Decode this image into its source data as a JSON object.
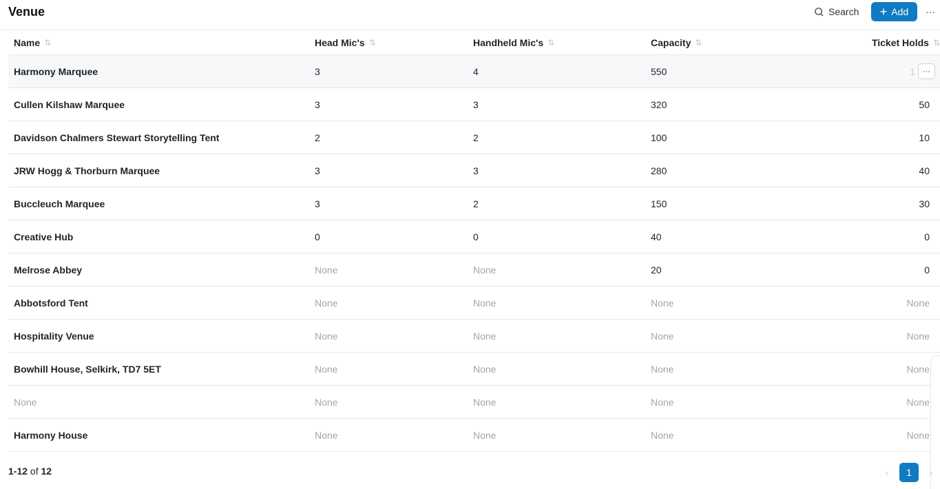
{
  "header": {
    "title": "Venue",
    "search_label": "Search",
    "add_label": "Add",
    "more_label": "···"
  },
  "table": {
    "columns": [
      "Name",
      "Head Mic's",
      "Handheld Mic's",
      "Capacity",
      "Ticket Holds"
    ],
    "sort_icon": "⇅",
    "rows": [
      {
        "name": "Harmony Marquee",
        "head": "3",
        "handheld": "4",
        "capacity": "550",
        "holds": "1"
      },
      {
        "name": "Cullen Kilshaw Marquee",
        "head": "3",
        "handheld": "3",
        "capacity": "320",
        "holds": "50"
      },
      {
        "name": "Davidson Chalmers Stewart Storytelling Tent",
        "head": "2",
        "handheld": "2",
        "capacity": "100",
        "holds": "10"
      },
      {
        "name": "JRW Hogg & Thorburn Marquee",
        "head": "3",
        "handheld": "3",
        "capacity": "280",
        "holds": "40"
      },
      {
        "name": "Buccleuch Marquee",
        "head": "3",
        "handheld": "2",
        "capacity": "150",
        "holds": "30"
      },
      {
        "name": "Creative Hub",
        "head": "0",
        "handheld": "0",
        "capacity": "40",
        "holds": "0"
      },
      {
        "name": "Melrose Abbey",
        "head": "None",
        "handheld": "None",
        "capacity": "20",
        "holds": "0"
      },
      {
        "name": "Abbotsford Tent",
        "head": "None",
        "handheld": "None",
        "capacity": "None",
        "holds": "None"
      },
      {
        "name": "Hospitality Venue",
        "head": "None",
        "handheld": "None",
        "capacity": "None",
        "holds": "None"
      },
      {
        "name": "Bowhill House, Selkirk, TD7 5ET",
        "head": "None",
        "handheld": "None",
        "capacity": "None",
        "holds": "None"
      },
      {
        "name": "None",
        "head": "None",
        "handheld": "None",
        "capacity": "None",
        "holds": "None"
      },
      {
        "name": "Harmony House",
        "head": "None",
        "handheld": "None",
        "capacity": "None",
        "holds": "None"
      }
    ],
    "row_action_label": "···"
  },
  "footer": {
    "range": "1-12",
    "of_label": "of",
    "total": "12"
  },
  "pagination": {
    "prev": "‹",
    "current_page": "1",
    "next": "›"
  },
  "colors": {
    "accent": "#0f7bc3",
    "muted_text": "#a1a6ad"
  }
}
